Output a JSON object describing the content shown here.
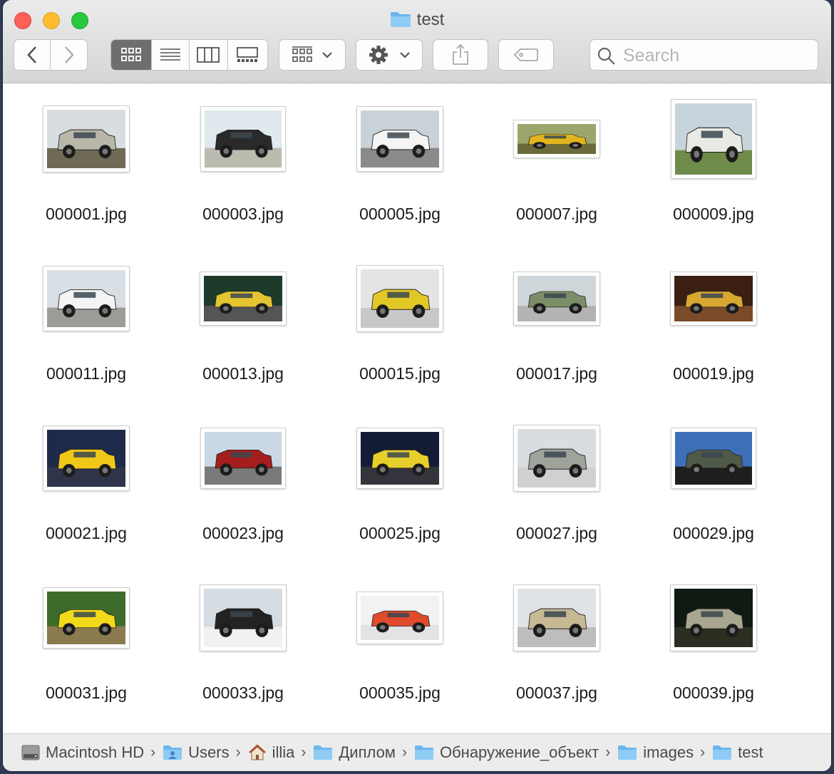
{
  "window": {
    "title": "test"
  },
  "toolbar": {
    "back_icon": "chevron-left-icon",
    "forward_icon": "chevron-right-icon",
    "view_modes": [
      "icon-view-icon",
      "list-view-icon",
      "column-view-icon",
      "gallery-view-icon"
    ],
    "active_view": "icon-view-icon",
    "group_icon": "group-by-icon",
    "action_icon": "gear-icon",
    "share_icon": "share-icon",
    "tag_icon": "tag-icon"
  },
  "search": {
    "placeholder": "Search"
  },
  "files": [
    {
      "name": "000001.jpg",
      "sky": "#d8dde0",
      "car": "#b9b7a9",
      "ground": "#6f6a55"
    },
    {
      "name": "000003.jpg",
      "sky": "#dfe9ee",
      "car": "#2a2a2a",
      "ground": "#bcbbb0"
    },
    {
      "name": "000005.jpg",
      "sky": "#c9d2d8",
      "car": "#f4f4f4",
      "ground": "#8a8a8a"
    },
    {
      "name": "000007.jpg",
      "sky": "#9aa66b",
      "car": "#e2b51e",
      "ground": "#6a6a3a"
    },
    {
      "name": "000009.jpg",
      "sky": "#c8d4dc",
      "car": "#e9e9e6",
      "ground": "#6f8b4a"
    },
    {
      "name": "000011.jpg",
      "sky": "#d8dfe4",
      "car": "#f4f4f4",
      "ground": "#9c9c98"
    },
    {
      "name": "000013.jpg",
      "sky": "#1e3a2a",
      "car": "#e3c431",
      "ground": "#555555"
    },
    {
      "name": "000015.jpg",
      "sky": "#e4e4e4",
      "car": "#e2c825",
      "ground": "#c8c8c8"
    },
    {
      "name": "000017.jpg",
      "sky": "#cfd6d9",
      "car": "#7c8e67",
      "ground": "#b3b3b3"
    },
    {
      "name": "000019.jpg",
      "sky": "#3a1f12",
      "car": "#d6a831",
      "ground": "#7a4b28"
    },
    {
      "name": "000021.jpg",
      "sky": "#1e2a4a",
      "car": "#f0c818",
      "ground": "#30344a"
    },
    {
      "name": "000023.jpg",
      "sky": "#c9d8e4",
      "car": "#a51d1d",
      "ground": "#7a7a7a"
    },
    {
      "name": "000025.jpg",
      "sky": "#121c34",
      "car": "#e8d02c",
      "ground": "#34353c"
    },
    {
      "name": "000027.jpg",
      "sky": "#d9dde0",
      "car": "#9fa39a",
      "ground": "#d0d0d0"
    },
    {
      "name": "000029.jpg",
      "sky": "#3c6fb8",
      "car": "#4f5a49",
      "ground": "#1e1e1e"
    },
    {
      "name": "000031.jpg",
      "sky": "#3d6b2a",
      "car": "#f2d91a",
      "ground": "#8c7a4f"
    },
    {
      "name": "000033.jpg",
      "sky": "#d6dde2",
      "car": "#222222",
      "ground": "#f1f1f1"
    },
    {
      "name": "000035.jpg",
      "sky": "#f2f2f2",
      "car": "#e04b2c",
      "ground": "#e3e3e3"
    },
    {
      "name": "000037.jpg",
      "sky": "#dfe3e6",
      "car": "#c6b994",
      "ground": "#bdbdbd"
    },
    {
      "name": "000039.jpg",
      "sky": "#0f1a12",
      "car": "#a8a68e",
      "ground": "#2a2f22"
    }
  ],
  "path": [
    {
      "label": "Macintosh HD",
      "icon": "hard-drive-icon"
    },
    {
      "label": "Users",
      "icon": "users-folder-icon"
    },
    {
      "label": "illia",
      "icon": "home-icon"
    },
    {
      "label": "Диплом",
      "icon": "folder-icon"
    },
    {
      "label": "Обнаружение_объект",
      "icon": "folder-icon"
    },
    {
      "label": "images",
      "icon": "folder-icon"
    },
    {
      "label": "test",
      "icon": "folder-icon"
    }
  ]
}
